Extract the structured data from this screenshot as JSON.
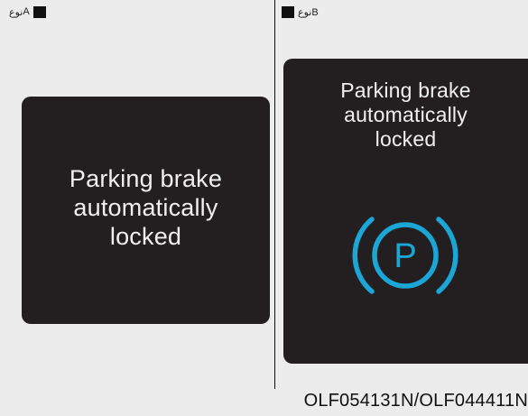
{
  "type_a": {
    "label": "نوع",
    "letter": "A"
  },
  "type_b": {
    "label": "نوع",
    "letter": "B"
  },
  "panel_a": {
    "message_lines": [
      "Parking brake",
      "automatically",
      "locked"
    ]
  },
  "panel_b": {
    "message_lines": [
      "Parking brake",
      "automatically",
      "locked"
    ],
    "indicator_icon": "parking-brake-icon",
    "indicator_letter": "P",
    "indicator_color": "#1ba6d6"
  },
  "caption": "OLF054131N/OLF044411N",
  "colors": {
    "background": "#ececec",
    "panel": "#231f20",
    "text": "#f0f0f0"
  }
}
